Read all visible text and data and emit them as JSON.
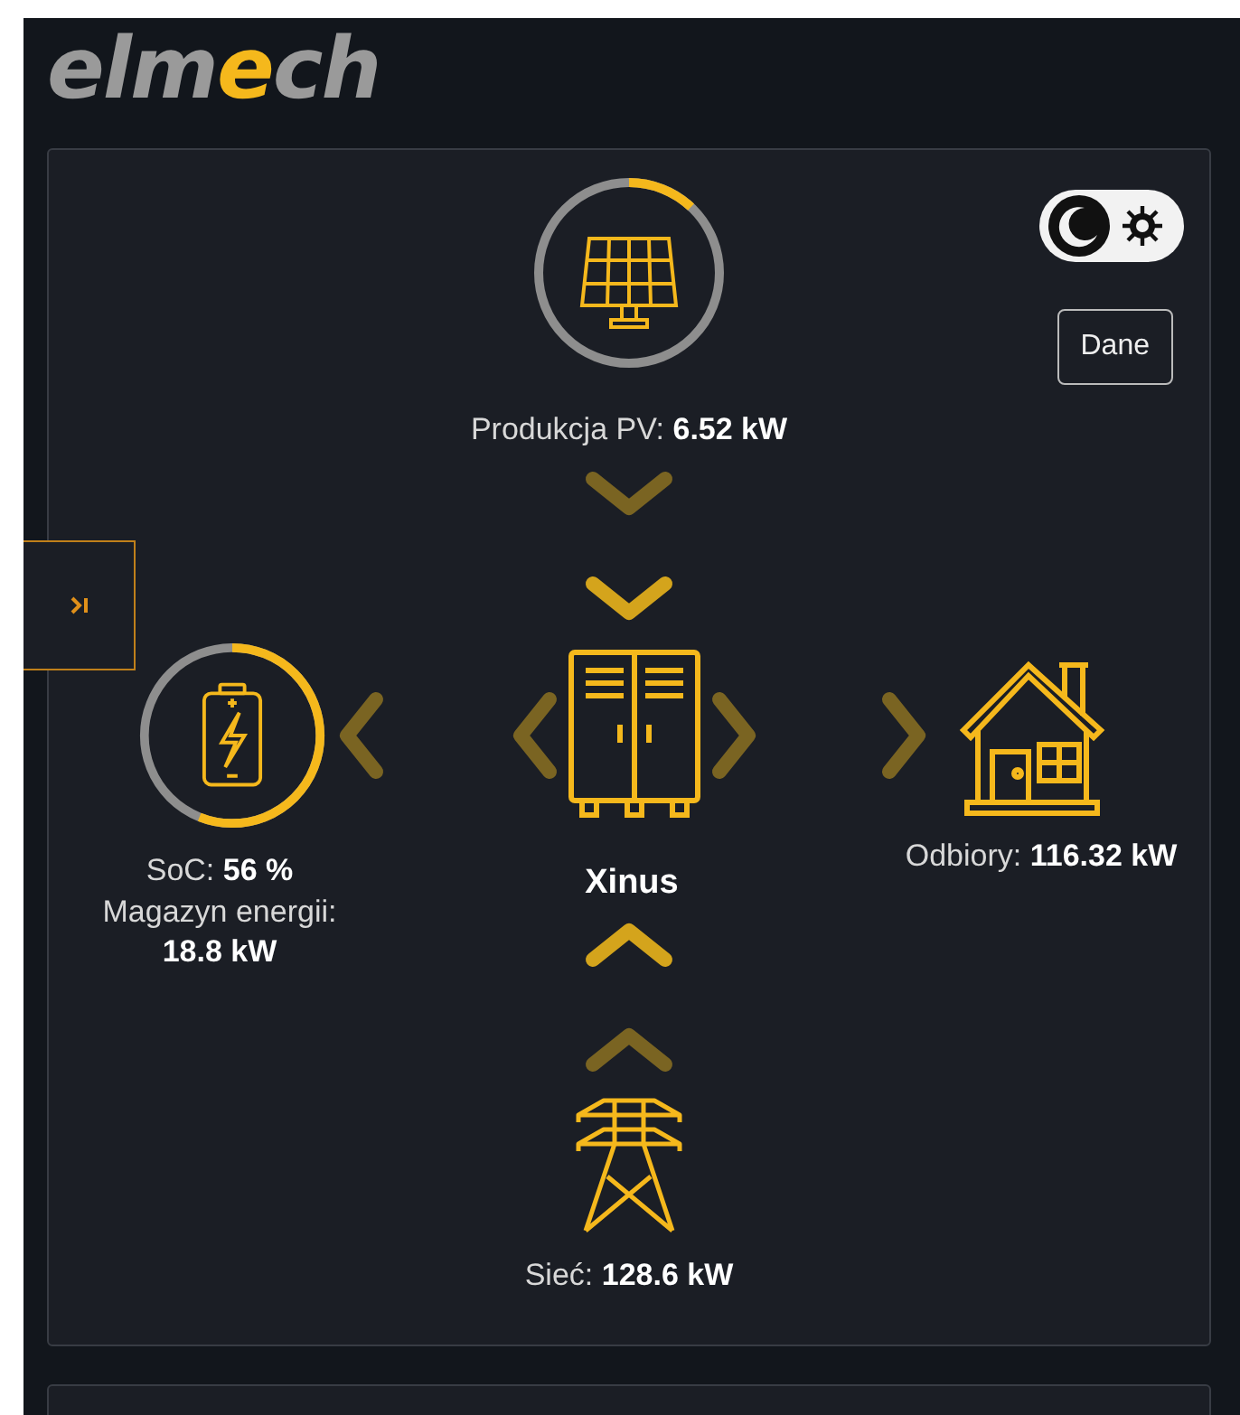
{
  "logo": [
    {
      "text": "elm",
      "accent": false
    },
    {
      "text": "e",
      "accent": true
    },
    {
      "text": "ch",
      "accent": false
    }
  ],
  "theme_toggle": {
    "dark": true
  },
  "data_button": "Dane",
  "pv": {
    "label": "Produkcja PV: **6.52 kW**",
    "level": 0.12
  },
  "arrows": {
    "pv": [
      {
        "active": false
      },
      {
        "active": true
      }
    ],
    "battery": [
      {
        "active": false
      }
    ],
    "inverter_left": [
      {
        "active": false
      }
    ],
    "inverter_right": [
      {
        "active": false
      }
    ],
    "load": [
      {
        "active": false
      }
    ],
    "grid": [
      {
        "active": true
      },
      {
        "active": false
      }
    ]
  },
  "battery": {
    "level": 0.56,
    "soc": "SoC: **56 %**",
    "storage": "Magazyn energii: **18.8 kW**"
  },
  "inverter": {
    "name": "Xinus"
  },
  "load": {
    "label": "Odbiory: **116.32 kW**"
  },
  "grid": {
    "label": "Sieć: **128.6 kW**"
  }
}
